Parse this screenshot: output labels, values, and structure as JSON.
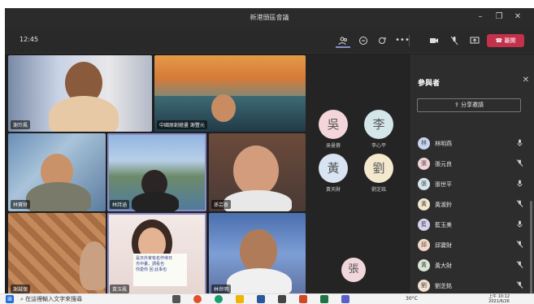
{
  "window": {
    "title": "新港頭區會議",
    "minimize": "–",
    "maximize": "❐",
    "close": "✕"
  },
  "toolbar": {
    "time": "12:45",
    "leave_label": "離開",
    "icons": [
      "people-icon",
      "chat-icon",
      "reactions-icon",
      "more-icon",
      "camera-off-icon",
      "mic-off-icon",
      "share-screen-icon",
      "phone-icon"
    ]
  },
  "videos": [
    {
      "name": "謝玲鳳"
    },
    {
      "name": "中國原創繪畫  謝豐元"
    },
    {
      "name": "林寶財"
    },
    {
      "name": "林詩涵"
    },
    {
      "name": "孫芸香"
    },
    {
      "name": "謝誠保"
    },
    {
      "name": "黃玉鳳"
    },
    {
      "name": "林世明"
    }
  ],
  "video_note": "是日外家有名作待日\n光中畫，請看也\n你愛你 回 此事也",
  "avatars": [
    {
      "char": "吳",
      "name": "吳曼蓉",
      "color": "#f4d6da"
    },
    {
      "char": "李",
      "name": "李心平",
      "color": "#d4e6ea"
    },
    {
      "char": "黃",
      "name": "黃天財",
      "color": "#d8e4f2"
    },
    {
      "char": "劉",
      "name": "劉芝銘",
      "color": "#f4e9cf"
    },
    {
      "char": "張",
      "name": "",
      "color": "#f1d6dc"
    }
  ],
  "panel": {
    "title": "參與者",
    "share_label": "分享邀請",
    "participants": [
      {
        "initials": "林",
        "name": "林明燕",
        "color": "#c9d6f0",
        "muted": false
      },
      {
        "initials": "張",
        "name": "張元良",
        "color": "#f1d4da",
        "muted": true
      },
      {
        "initials": "張",
        "name": "張世平",
        "color": "#d5e7ec",
        "muted": false
      },
      {
        "initials": "黃",
        "name": "黃淑鈴",
        "color": "#f3e8cf",
        "muted": true
      },
      {
        "initials": "藍",
        "name": "藍玉美",
        "color": "#d7d2ef",
        "muted": false
      },
      {
        "initials": "邱",
        "name": "邱寶財",
        "color": "#f4d8c6",
        "muted": true
      },
      {
        "initials": "黃",
        "name": "黃大財",
        "color": "#d9e7d4",
        "muted": true
      },
      {
        "initials": "劉",
        "name": "劉芝銘",
        "color": "#f2e0cf",
        "muted": true
      }
    ]
  },
  "taskbar": {
    "search_placeholder": "在這裡輸入文字來搜尋",
    "weather": "30°C",
    "time": "上午 10:12",
    "date": "2021/6/26"
  }
}
